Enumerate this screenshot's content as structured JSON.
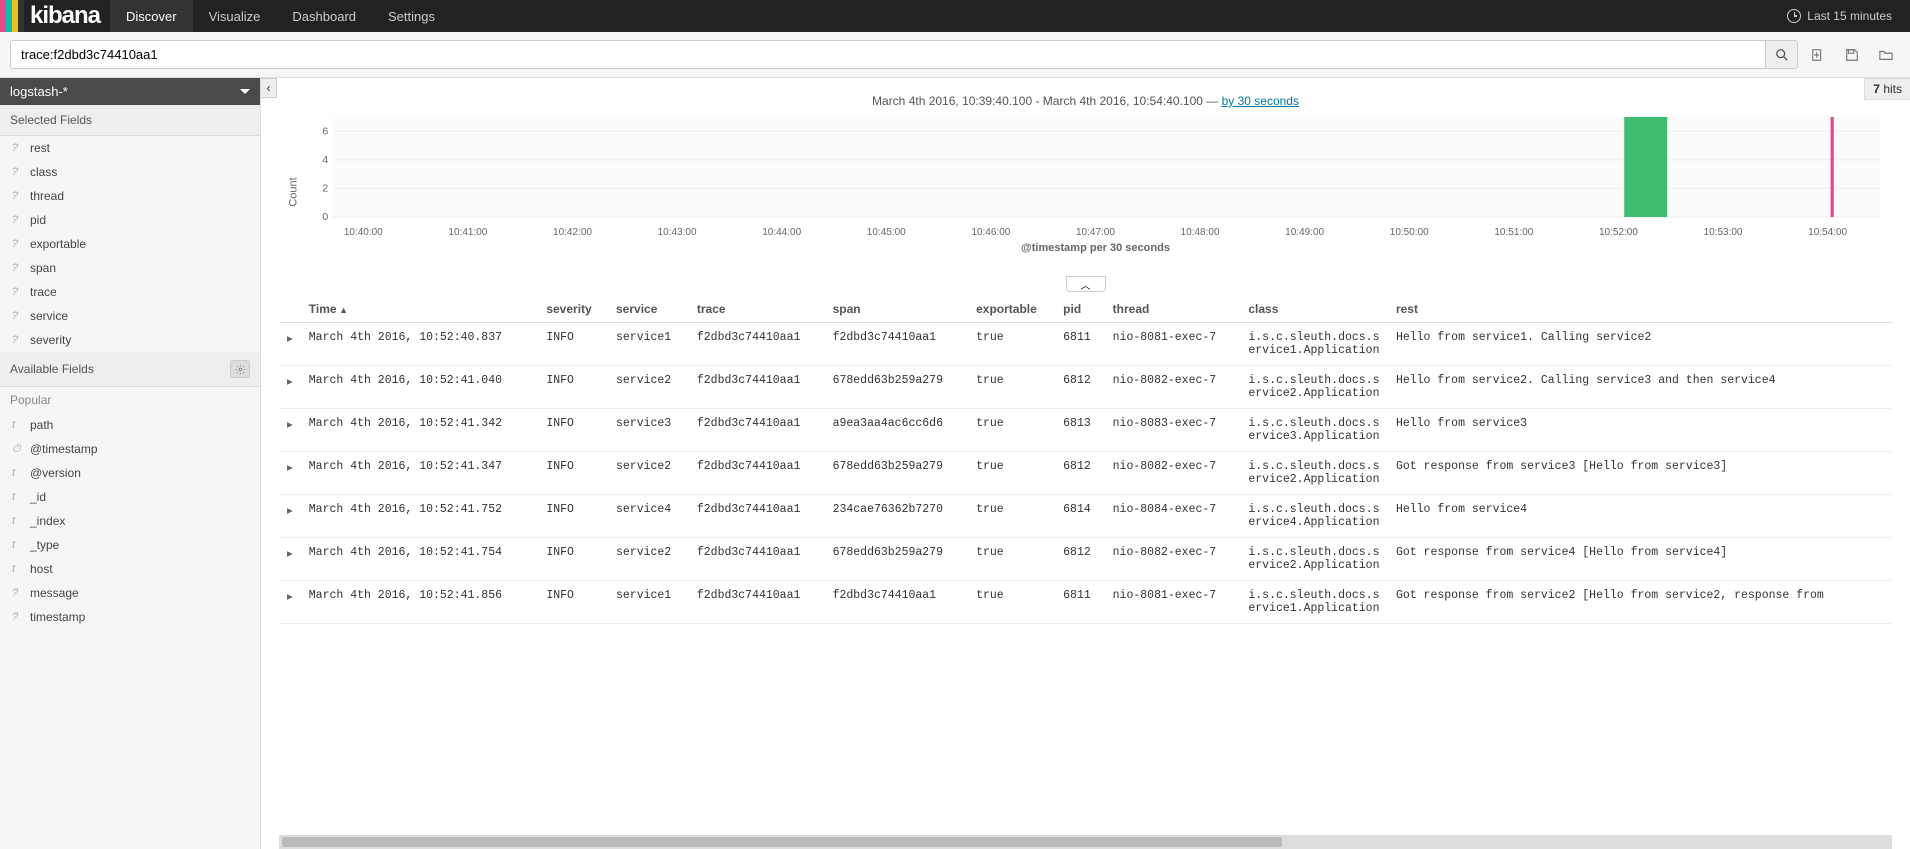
{
  "brand": "kibana",
  "nav": {
    "tabs": [
      "Discover",
      "Visualize",
      "Dashboard",
      "Settings"
    ],
    "active": 0,
    "time_label": "Last 15 minutes"
  },
  "search": {
    "query": "trace:f2dbd3c74410aa1"
  },
  "index_pattern": "logstash-*",
  "hits": {
    "count": "7",
    "label": "hits"
  },
  "sidebar": {
    "selected_label": "Selected Fields",
    "available_label": "Available Fields",
    "popular_label": "Popular",
    "selected": [
      {
        "t": "?",
        "n": "rest"
      },
      {
        "t": "?",
        "n": "class"
      },
      {
        "t": "?",
        "n": "thread"
      },
      {
        "t": "?",
        "n": "pid"
      },
      {
        "t": "?",
        "n": "exportable"
      },
      {
        "t": "?",
        "n": "span"
      },
      {
        "t": "?",
        "n": "trace"
      },
      {
        "t": "?",
        "n": "service"
      },
      {
        "t": "?",
        "n": "severity"
      }
    ],
    "available": [
      {
        "t": "t",
        "n": "path"
      },
      {
        "t": "⏱",
        "n": "@timestamp"
      },
      {
        "t": "t",
        "n": "@version"
      },
      {
        "t": "t",
        "n": "_id"
      },
      {
        "t": "t",
        "n": "_index"
      },
      {
        "t": "t",
        "n": "_type"
      },
      {
        "t": "t",
        "n": "host"
      },
      {
        "t": "?",
        "n": "message"
      },
      {
        "t": "?",
        "n": "timestamp"
      }
    ]
  },
  "timebar": {
    "range": "March 4th 2016, 10:39:40.100 - March 4th 2016, 10:54:40.100 — ",
    "interval": "by 30 seconds"
  },
  "chart_data": {
    "type": "bar",
    "ylabel": "Count",
    "xlabel": "@timestamp per 30 seconds",
    "ylim": [
      0,
      7
    ],
    "yticks": [
      0,
      2,
      4,
      6
    ],
    "x_categories": [
      "10:40:00",
      "10:41:00",
      "10:42:00",
      "10:43:00",
      "10:44:00",
      "10:45:00",
      "10:46:00",
      "10:47:00",
      "10:48:00",
      "10:49:00",
      "10:50:00",
      "10:51:00",
      "10:52:00",
      "10:53:00",
      "10:54:00"
    ],
    "bars": [
      {
        "bucket_index": 25,
        "value": 7,
        "color": "#3ebd70"
      },
      {
        "bucket_index": 29,
        "value": 7,
        "color": "#e8488b"
      }
    ],
    "total_buckets": 30
  },
  "columns": [
    "Time",
    "severity",
    "service",
    "trace",
    "span",
    "exportable",
    "pid",
    "thread",
    "class",
    "rest"
  ],
  "rows": [
    {
      "time": "March 4th 2016, 10:52:40.837",
      "severity": "INFO",
      "service": "service1",
      "trace": "f2dbd3c74410aa1",
      "span": "f2dbd3c74410aa1",
      "exportable": "true",
      "pid": "6811",
      "thread": "nio-8081-exec-7",
      "class": "i.s.c.sleuth.docs.service1.Application",
      "rest": "Hello from service1. Calling service2"
    },
    {
      "time": "March 4th 2016, 10:52:41.040",
      "severity": "INFO",
      "service": "service2",
      "trace": "f2dbd3c74410aa1",
      "span": "678edd63b259a279",
      "exportable": "true",
      "pid": "6812",
      "thread": "nio-8082-exec-7",
      "class": "i.s.c.sleuth.docs.service2.Application",
      "rest": "Hello from service2. Calling service3 and then service4"
    },
    {
      "time": "March 4th 2016, 10:52:41.342",
      "severity": "INFO",
      "service": "service3",
      "trace": "f2dbd3c74410aa1",
      "span": "a9ea3aa4ac6cc6d6",
      "exportable": "true",
      "pid": "6813",
      "thread": "nio-8083-exec-7",
      "class": "i.s.c.sleuth.docs.service3.Application",
      "rest": "Hello from service3"
    },
    {
      "time": "March 4th 2016, 10:52:41.347",
      "severity": "INFO",
      "service": "service2",
      "trace": "f2dbd3c74410aa1",
      "span": "678edd63b259a279",
      "exportable": "true",
      "pid": "6812",
      "thread": "nio-8082-exec-7",
      "class": "i.s.c.sleuth.docs.service2.Application",
      "rest": "Got response from service3 [Hello from service3]"
    },
    {
      "time": "March 4th 2016, 10:52:41.752",
      "severity": "INFO",
      "service": "service4",
      "trace": "f2dbd3c74410aa1",
      "span": "234cae76362b7270",
      "exportable": "true",
      "pid": "6814",
      "thread": "nio-8084-exec-7",
      "class": "i.s.c.sleuth.docs.service4.Application",
      "rest": "Hello from service4"
    },
    {
      "time": "March 4th 2016, 10:52:41.754",
      "severity": "INFO",
      "service": "service2",
      "trace": "f2dbd3c74410aa1",
      "span": "678edd63b259a279",
      "exportable": "true",
      "pid": "6812",
      "thread": "nio-8082-exec-7",
      "class": "i.s.c.sleuth.docs.service2.Application",
      "rest": "Got response from service4 [Hello from service4]"
    },
    {
      "time": "March 4th 2016, 10:52:41.856",
      "severity": "INFO",
      "service": "service1",
      "trace": "f2dbd3c74410aa1",
      "span": "f2dbd3c74410aa1",
      "exportable": "true",
      "pid": "6811",
      "thread": "nio-8081-exec-7",
      "class": "i.s.c.sleuth.docs.service1.Application",
      "rest": "Got response from service2 [Hello from service2, response from"
    }
  ]
}
